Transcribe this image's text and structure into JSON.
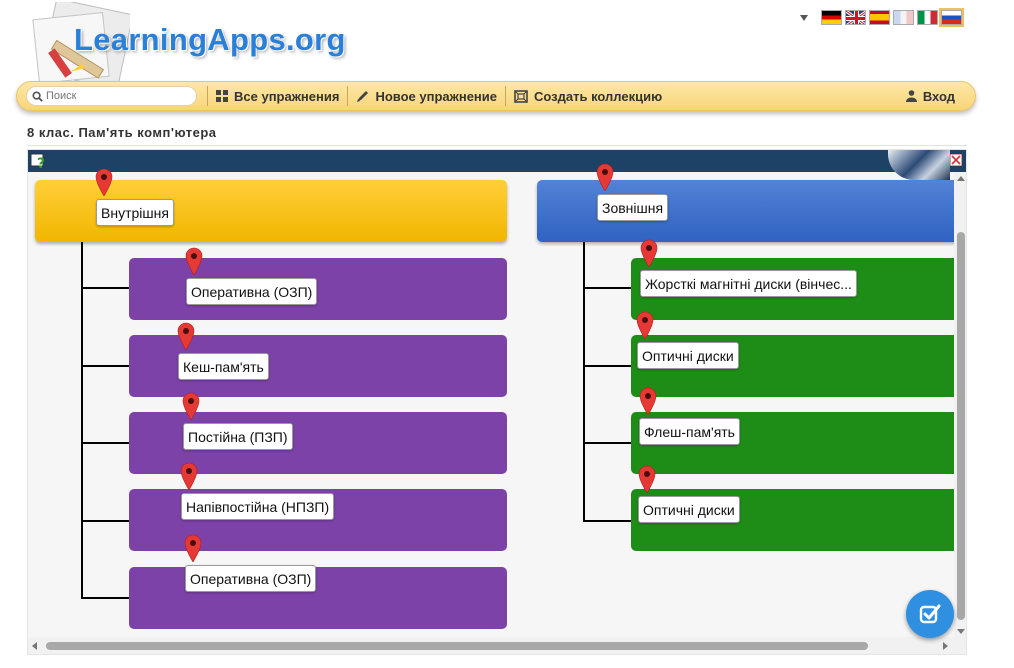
{
  "logo": {
    "text": "LearningApps.org"
  },
  "languages": [
    "de",
    "en",
    "es",
    "fr",
    "it",
    "ru"
  ],
  "nav": {
    "search_placeholder": "Поиск",
    "all_exercises": "Все упражнения",
    "new_exercise": "Новое упражнение",
    "create_collection": "Создать коллекцию",
    "login": "Вход"
  },
  "page": {
    "title": "8 клас. Пам'ять комп'ютера"
  },
  "app": {
    "left_group": {
      "heading": "Внутрішня",
      "items": [
        "Оперативна (ОЗП)",
        "Кеш-пам'ять",
        "Постійна (ПЗП)",
        "Напівпостійна (НПЗП)",
        "Оперативна (ОЗП)"
      ]
    },
    "right_group": {
      "heading": "Зовнішня",
      "items": [
        "Жорсткі магнітні диски (вінчес...",
        "Оптичні диски",
        "Флеш-пам'ять",
        "Оптичні диски"
      ]
    }
  },
  "colors": {
    "navbar": "#f8d57a",
    "logo_text": "#2a80d8",
    "head_left": "#f2b600",
    "head_right": "#2f62c2",
    "items_left": "#7d42a8",
    "items_right": "#1e8d17",
    "app_topbar": "#1e4166",
    "check_button": "#2f8fe0",
    "pin": "#e53935"
  },
  "icons": {
    "search": "search-icon",
    "grid": "grid-icon",
    "pencil": "pencil-icon",
    "collection": "collection-icon",
    "user": "user-icon",
    "help": "help-icon",
    "close": "close-icon",
    "check": "check-icon",
    "pin": "pin-icon"
  }
}
